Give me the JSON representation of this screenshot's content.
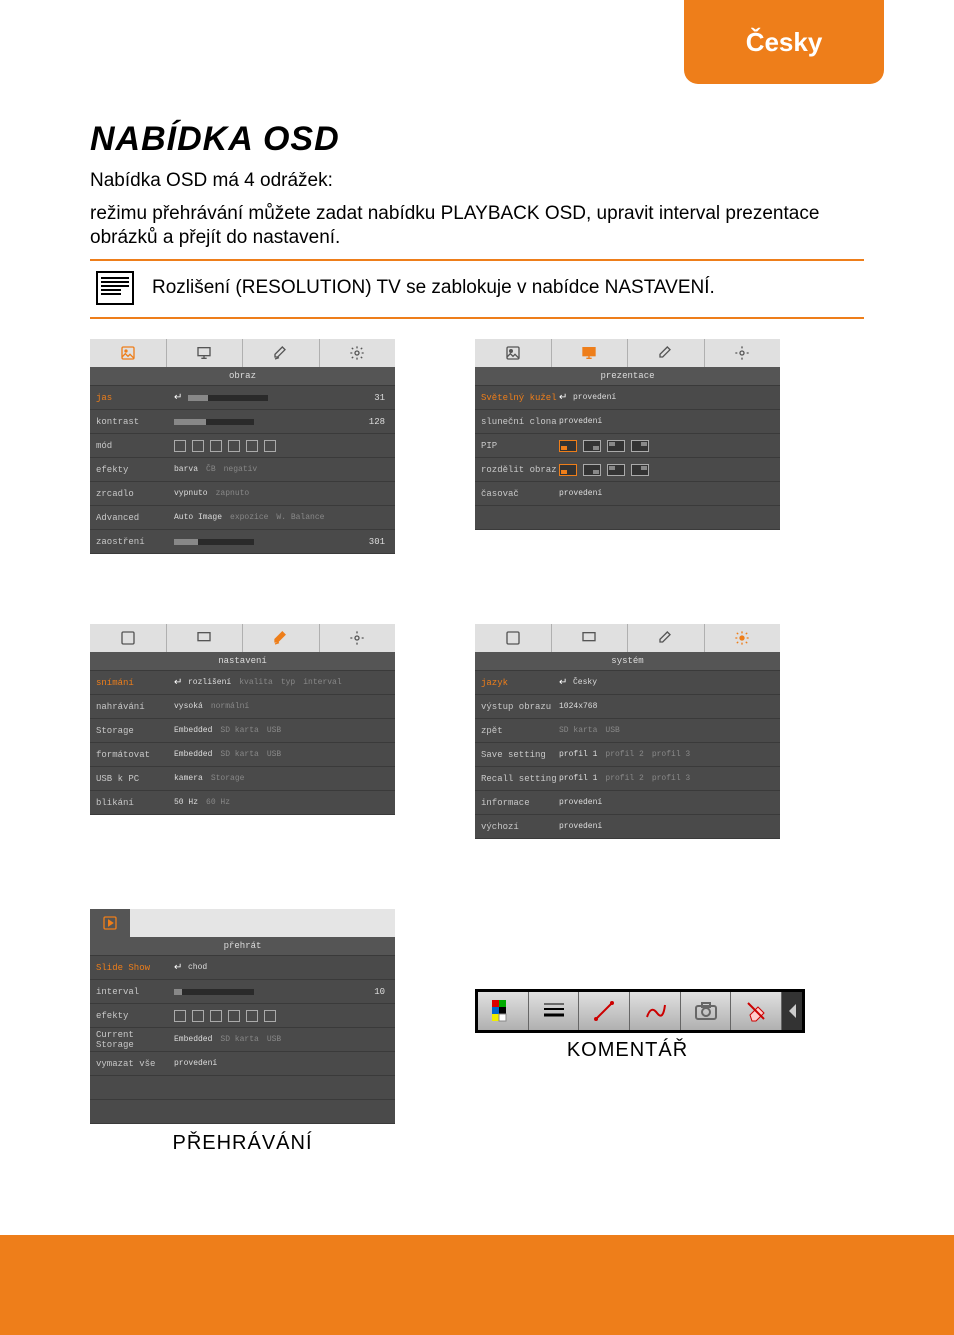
{
  "lang_tab": "Česky",
  "title": "NABÍDKA OSD",
  "intro_line1": "Nabídka OSD má 4 odrážek:",
  "intro_line2": "režimu přehrávání můžete zadat nabídku PLAYBACK OSD, upravit interval prezentace obrázků a přejít do nastavení.",
  "note": "Rozlišení (RESOLUTION) TV se zablokuje v nabídce NASTAVENÍ.",
  "panel_image": {
    "section": "obraz",
    "rows": [
      {
        "label": "jas",
        "selected": true,
        "slider": 25,
        "value": "31"
      },
      {
        "label": "kontrast",
        "slider": 40,
        "value": "128"
      },
      {
        "label": "mód",
        "icons": true
      },
      {
        "label": "efekty",
        "opts": [
          {
            "t": "barva",
            "on": true
          },
          {
            "t": "ČB"
          },
          {
            "t": "negativ"
          }
        ]
      },
      {
        "label": "zrcadlo",
        "opts": [
          {
            "t": "vypnuto",
            "on": true
          },
          {
            "t": "zapnuto"
          }
        ]
      },
      {
        "label": "Advanced",
        "opts": [
          {
            "t": "Auto Image",
            "on": true
          },
          {
            "t": "expozice"
          },
          {
            "t": "W. Balance"
          }
        ]
      },
      {
        "label": "zaostření",
        "slider": 30,
        "value": "301"
      }
    ]
  },
  "panel_presentation": {
    "section": "prezentace",
    "rows": [
      {
        "label": "Světelný kužel",
        "selected": true,
        "opts": [
          {
            "t": "provedení",
            "on": true
          }
        ]
      },
      {
        "label": "sluneční clona",
        "opts": [
          {
            "t": "provedení",
            "on": true
          }
        ]
      },
      {
        "label": "PIP",
        "pip": true
      },
      {
        "label": "rozdělit obraz",
        "pip": true
      },
      {
        "label": "časovač",
        "opts": [
          {
            "t": "provedení",
            "on": true
          }
        ]
      }
    ]
  },
  "panel_settings": {
    "section": "nastavení",
    "rows": [
      {
        "label": "snímání",
        "selected": true,
        "opts": [
          {
            "t": "rozlišení",
            "on": true
          },
          {
            "t": "kvalita"
          },
          {
            "t": "typ"
          },
          {
            "t": "interval"
          }
        ]
      },
      {
        "label": "nahrávání",
        "opts": [
          {
            "t": "vysoká",
            "on": true
          },
          {
            "t": "normální"
          }
        ]
      },
      {
        "label": "Storage",
        "opts": [
          {
            "t": "Embedded",
            "on": true
          },
          {
            "t": "SD karta"
          },
          {
            "t": "USB"
          }
        ]
      },
      {
        "label": "formátovat",
        "opts": [
          {
            "t": "Embedded",
            "on": true
          },
          {
            "t": "SD karta"
          },
          {
            "t": "USB"
          }
        ]
      },
      {
        "label": "USB k PC",
        "opts": [
          {
            "t": "kamera",
            "on": true
          },
          {
            "t": "Storage"
          }
        ]
      },
      {
        "label": "blikání",
        "opts": [
          {
            "t": "50 Hz",
            "on": true
          },
          {
            "t": "60 Hz"
          }
        ]
      }
    ]
  },
  "panel_system": {
    "section": "systém",
    "rows": [
      {
        "label": "jazyk",
        "selected": true,
        "opts": [
          {
            "t": "Česky",
            "on": true
          }
        ]
      },
      {
        "label": "výstup obrazu",
        "opts": [
          {
            "t": "1024x768",
            "on": true
          }
        ]
      },
      {
        "label": "zpět",
        "opts": [
          {
            "t": "SD karta"
          },
          {
            "t": "USB"
          }
        ]
      },
      {
        "label": "Save setting",
        "opts": [
          {
            "t": "profil 1",
            "on": true
          },
          {
            "t": "profil 2"
          },
          {
            "t": "profil 3"
          }
        ]
      },
      {
        "label": "Recall setting",
        "opts": [
          {
            "t": "profil 1",
            "on": true
          },
          {
            "t": "profil 2"
          },
          {
            "t": "profil 3"
          }
        ]
      },
      {
        "label": "informace",
        "opts": [
          {
            "t": "provedení",
            "on": true
          }
        ]
      },
      {
        "label": "výchozí",
        "opts": [
          {
            "t": "provedení",
            "on": true
          }
        ]
      }
    ]
  },
  "panel_playback": {
    "section": "přehrát",
    "rows": [
      {
        "label": "Slide Show",
        "selected": true,
        "opts": [
          {
            "t": "chod",
            "on": true
          }
        ]
      },
      {
        "label": "interval",
        "slider": 10,
        "value": "10"
      },
      {
        "label": "efekty",
        "fx_icons": true
      },
      {
        "label": "Current Storage",
        "opts": [
          {
            "t": "Embedded",
            "on": true
          },
          {
            "t": "SD karta"
          },
          {
            "t": "USB"
          }
        ]
      },
      {
        "label": "vymazat vše",
        "opts": [
          {
            "t": "provedení",
            "on": true
          }
        ]
      }
    ],
    "caption": "PŘEHRÁVÁNÍ"
  },
  "annotation_caption": "KOMENTÁŘ"
}
